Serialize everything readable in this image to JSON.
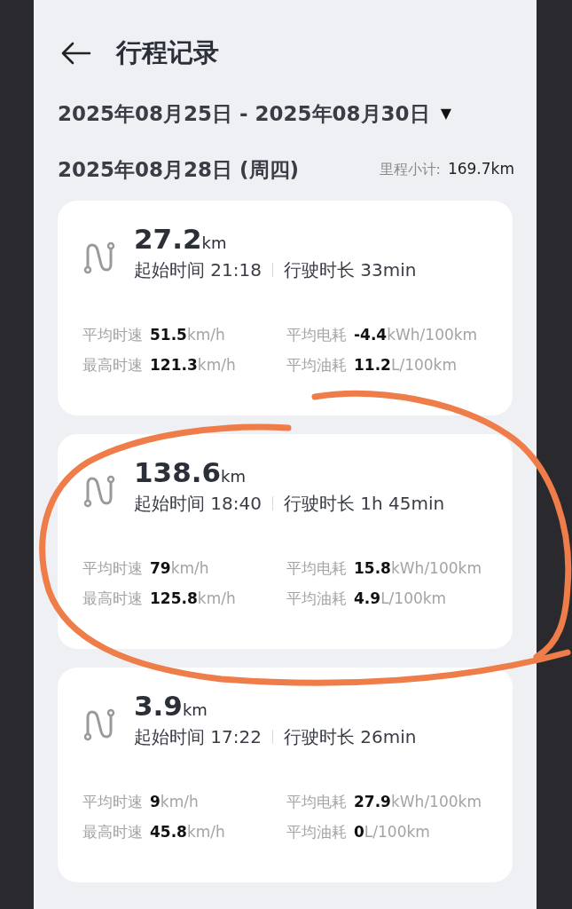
{
  "header": {
    "title": "行程记录"
  },
  "date_range": {
    "text": "2025年08月25日 - 2025年08月30日",
    "symbol": "▼"
  },
  "day": {
    "date": "2025年08月28日 (周四)",
    "subtotal_label": "里程小计:",
    "subtotal_value": "169.7km"
  },
  "trips": [
    {
      "distance": "27.2",
      "unit": "km",
      "start": "起始时间 21:18",
      "duration": "行驶时长 33min",
      "stats": [
        {
          "label": "平均时速",
          "value": "**51.5**km/h"
        },
        {
          "label": "平均电耗",
          "value": "**-4.4**kWh/100km"
        },
        {
          "label": "最高时速",
          "value": "**121.3**km/h"
        },
        {
          "label": "平均油耗",
          "value": "**11.2**L/100km"
        }
      ]
    },
    {
      "distance": "138.6",
      "unit": "km",
      "start": "起始时间 18:40",
      "duration": "行驶时长 1h 45min",
      "stats": [
        {
          "label": "平均时速",
          "value": "**79**km/h"
        },
        {
          "label": "平均电耗",
          "value": "**15.8**kWh/100km"
        },
        {
          "label": "最高时速",
          "value": "**125.8**km/h"
        },
        {
          "label": "平均油耗",
          "value": "**4.9**L/100km"
        }
      ]
    },
    {
      "distance": "3.9",
      "unit": "km",
      "start": "起始时间 17:22",
      "duration": "行驶时长 26min",
      "stats": [
        {
          "label": "平均时速",
          "value": "**9**km/h"
        },
        {
          "label": "平均电耗",
          "value": "**27.9**kWh/100km"
        },
        {
          "label": "最高时速",
          "value": "**45.8**km/h"
        },
        {
          "label": "平均油耗",
          "value": "**0**L/100km"
        }
      ]
    }
  ]
}
